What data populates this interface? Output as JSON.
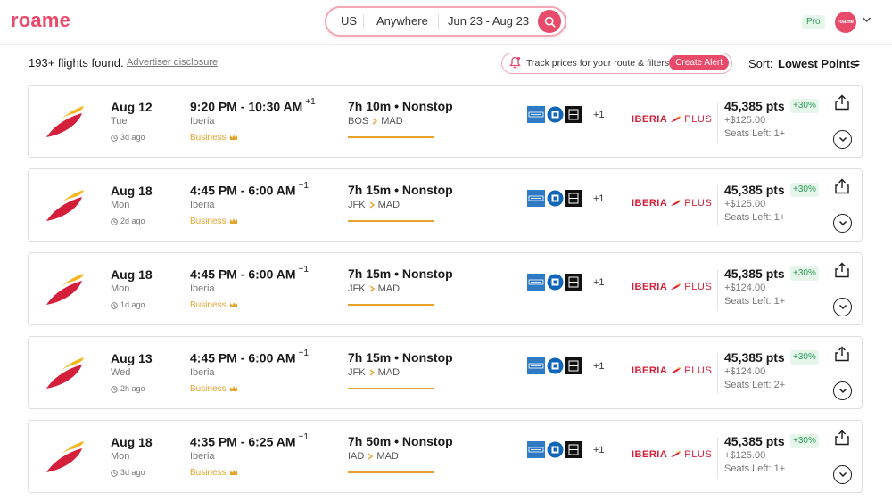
{
  "header": {
    "logo": "roame",
    "search": {
      "origin": "US",
      "destination": "Anywhere",
      "dates": "Jun 23 - Aug 23"
    },
    "pro_badge": "Pro",
    "avatar_text": "roame"
  },
  "results": {
    "count_text": "193+ flights found.",
    "disclosure": "Advertiser disclosure",
    "track_text": "Track prices for your route & filters",
    "alert_button": "Create Alert",
    "sort_label": "Sort:",
    "sort_value": "Lowest Points"
  },
  "colors": {
    "brand": "#e84a6a",
    "gold": "#e6a22a",
    "green": "#2a9d55",
    "iberia_red": "#d31f3a"
  },
  "flights": [
    {
      "date": "Aug 12",
      "dow": "Tue",
      "ago": "3d ago",
      "times": "9:20 PM - 10:30 AM",
      "plus_day": "+1",
      "airline": "Iberia",
      "cabin": "Business",
      "duration": "7h 10m • Nonstop",
      "from": "BOS",
      "to": "MAD",
      "more_cards": "+1",
      "program": "IBERIA",
      "program_suffix": "PLUS",
      "points": "45,385 pts",
      "pct": "+30%",
      "fee": "+$125.00",
      "seats": "Seats Left: 1+"
    },
    {
      "date": "Aug 18",
      "dow": "Mon",
      "ago": "2d ago",
      "times": "4:45 PM - 6:00 AM",
      "plus_day": "+1",
      "airline": "Iberia",
      "cabin": "Business",
      "duration": "7h 15m • Nonstop",
      "from": "JFK",
      "to": "MAD",
      "more_cards": "+1",
      "program": "IBERIA",
      "program_suffix": "PLUS",
      "points": "45,385 pts",
      "pct": "+30%",
      "fee": "+$125.00",
      "seats": "Seats Left: 1+"
    },
    {
      "date": "Aug 18",
      "dow": "Mon",
      "ago": "1d ago",
      "times": "4:45 PM - 6:00 AM",
      "plus_day": "+1",
      "airline": "Iberia",
      "cabin": "Business",
      "duration": "7h 15m • Nonstop",
      "from": "JFK",
      "to": "MAD",
      "more_cards": "+1",
      "program": "IBERIA",
      "program_suffix": "PLUS",
      "points": "45,385 pts",
      "pct": "+30%",
      "fee": "+$124.00",
      "seats": "Seats Left: 1+"
    },
    {
      "date": "Aug 13",
      "dow": "Wed",
      "ago": "2h ago",
      "times": "4:45 PM - 6:00 AM",
      "plus_day": "+1",
      "airline": "Iberia",
      "cabin": "Business",
      "duration": "7h 15m • Nonstop",
      "from": "JFK",
      "to": "MAD",
      "more_cards": "+1",
      "program": "IBERIA",
      "program_suffix": "PLUS",
      "points": "45,385 pts",
      "pct": "+30%",
      "fee": "+$124.00",
      "seats": "Seats Left: 2+"
    },
    {
      "date": "Aug 18",
      "dow": "Mon",
      "ago": "3d ago",
      "times": "4:35 PM - 6:25 AM",
      "plus_day": "+1",
      "airline": "Iberia",
      "cabin": "Business",
      "duration": "7h 50m • Nonstop",
      "from": "IAD",
      "to": "MAD",
      "more_cards": "+1",
      "program": "IBERIA",
      "program_suffix": "PLUS",
      "points": "45,385 pts",
      "pct": "+30%",
      "fee": "+$125.00",
      "seats": "Seats Left: 1+"
    }
  ],
  "icons": [
    "search-icon",
    "chevron-down-icon",
    "bell-icon",
    "sort-icon",
    "clock-icon",
    "crown-icon",
    "chevron-right-icon",
    "amex-icon",
    "chase-icon",
    "bilt-icon",
    "share-icon",
    "expand-icon",
    "iberia-logo-icon"
  ]
}
